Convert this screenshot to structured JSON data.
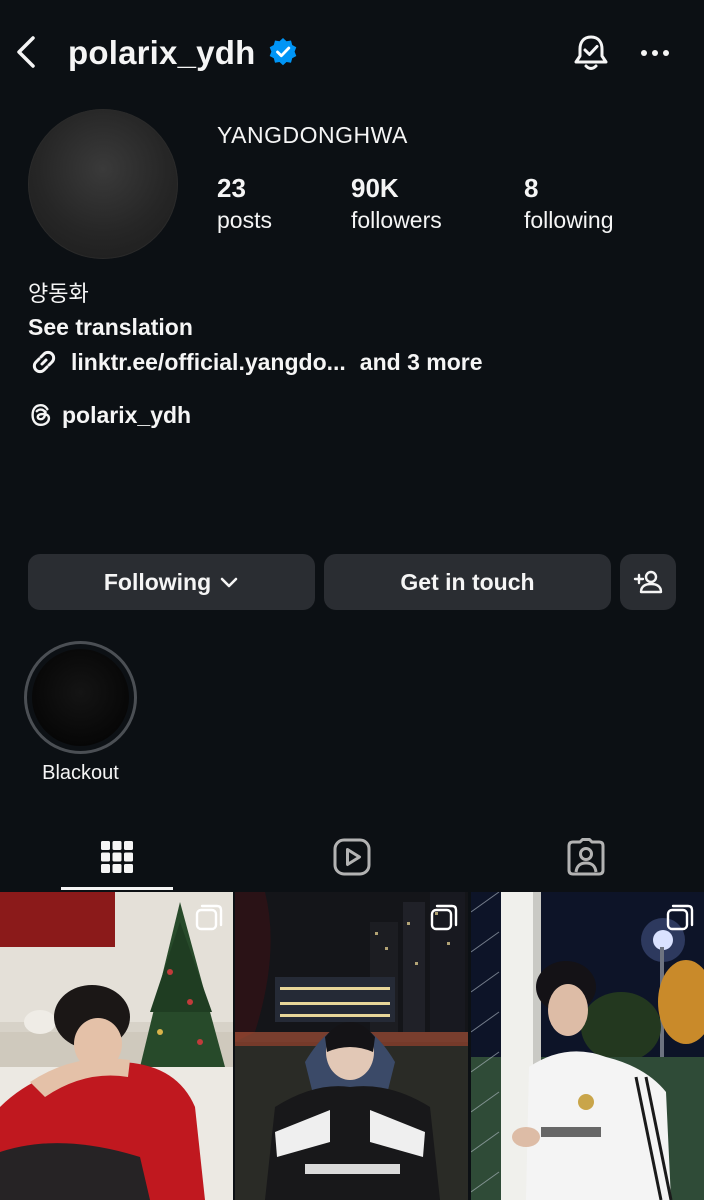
{
  "header": {
    "username": "polarix_ydh",
    "verified_color": "#0095f6"
  },
  "profile": {
    "display_name": "YANGDONGHWA",
    "stats": {
      "posts": {
        "value": "23",
        "label": "posts"
      },
      "followers": {
        "value": "90K",
        "label": "followers"
      },
      "following": {
        "value": "8",
        "label": "following"
      }
    },
    "bio_name": "양동화",
    "see_translation": "See translation",
    "link_text": "linktr.ee/official.yangdo...",
    "link_more": "and 3 more",
    "threads_handle": "polarix_ydh"
  },
  "actions": {
    "following_label": "Following",
    "contact_label": "Get in touch"
  },
  "highlights": [
    {
      "label": "Blackout"
    }
  ],
  "tabs": [
    {
      "name": "grid-icon",
      "active": true
    },
    {
      "name": "reels-icon",
      "active": false
    },
    {
      "name": "tagged-icon",
      "active": false
    }
  ],
  "posts": [
    {
      "type": "carousel",
      "icon": "carousel-icon"
    },
    {
      "type": "carousel",
      "icon": "carousel-icon"
    },
    {
      "type": "carousel",
      "icon": "carousel-icon"
    }
  ],
  "colors": {
    "background": "#0c1014",
    "button_bg": "#2a2d32",
    "text": "#f5f5f5"
  }
}
